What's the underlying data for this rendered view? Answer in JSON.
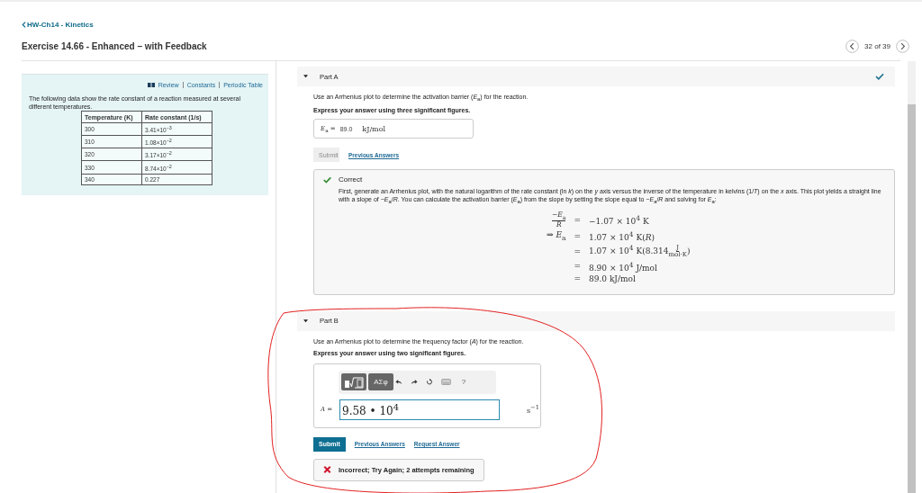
{
  "breadcrumb": "HW-Ch14 - Kinetics",
  "title": "Exercise 14.66 - Enhanced – with Feedback",
  "pager": {
    "counter": "32 of 39"
  },
  "resources": {
    "links": [
      "Review",
      "Constants",
      "Periodic Table"
    ],
    "intro": "The following data show the rate constant of a reaction measured at several different temperatures.",
    "table": {
      "columns": [
        "Temperature (K)",
        "Rate constant (1/s)"
      ],
      "rows": [
        [
          "300",
          "3.41×10$^{−3}$"
        ],
        [
          "310",
          "1.08×10$^{−2}$"
        ],
        [
          "320",
          "3.17×10$^{−2}$"
        ],
        [
          "330",
          "8.74×10$^{−2}$"
        ],
        [
          "340",
          "0.227"
        ]
      ]
    }
  },
  "part_a": {
    "title": "Part A",
    "expanded": true,
    "complete": true,
    "question": "Use an Arrhenius plot to determine the activation barrier (*E*$_{a}$) for the reaction.",
    "instruction": "Express your answer using three significant figures.",
    "answer": {
      "label": "*E*$_{a}$ =",
      "value": "89.0",
      "unit": "kJ/mol"
    },
    "submit": {
      "label": "Submit",
      "disabled": true
    },
    "links": [
      "Previous Answers"
    ],
    "feedback": {
      "kind": "correct",
      "heading": "Correct",
      "text": "First, generate an Arrhenius plot, with the natural logarithm of the rate constant (ln *k*) on the *y* axis versus the inverse of the temperature in kelvins (1/*T*) on the *x* axis. This plot yields a straight line with a slope of −*E*$_{a}$/*R*. You can calculate the activation barrier (*E*$_{a}$) from the slope by setting the slope equal to −*E*$_{a}$/*R* and solving for *E*$_{a}$:",
      "steps": [
        {
          "lhs_fraction": {
            "num": "−*E*$_{a}$",
            "den": "*R*"
          },
          "rel": "=",
          "rhs": "−1.07 × 10$^{4}$ K"
        },
        {
          "lhs": "⇒ *E*$_{a}$",
          "rel": "=",
          "rhs": "1.07 × 10$^{4}$ K(*R*)"
        },
        {
          "rel": "=",
          "rhs": "1.07 × 10$^{4}$ K(8.314",
          "rhs_fraction": {
            "num": "J",
            "den": "mol·K"
          },
          "rhs_after": ")"
        },
        {
          "rel": "=",
          "rhs": "8.90 × 10$^{4}$ J/mol"
        },
        {
          "rel": "=",
          "rhs": "89.0 kJ/mol"
        }
      ]
    }
  },
  "part_b": {
    "title": "Part B",
    "expanded": true,
    "complete": false,
    "question": "Use an Arrhenius plot to determine the frequency factor (*A*) for the reaction.",
    "instruction": "Express your answer using two significant figures.",
    "toolbar": {
      "symbols": "ΑΣφ",
      "help": "?"
    },
    "answer": {
      "label": "*A* =",
      "value": "9.58 • 10$^{4}$",
      "unit": "s$^{−1}$"
    },
    "submit": {
      "label": "Submit",
      "disabled": false
    },
    "links": [
      "Previous Answers",
      "Request Answer"
    ],
    "feedback": {
      "kind": "incorrect",
      "heading": "Incorrect; Try Again; 2 attempts remaining"
    }
  }
}
